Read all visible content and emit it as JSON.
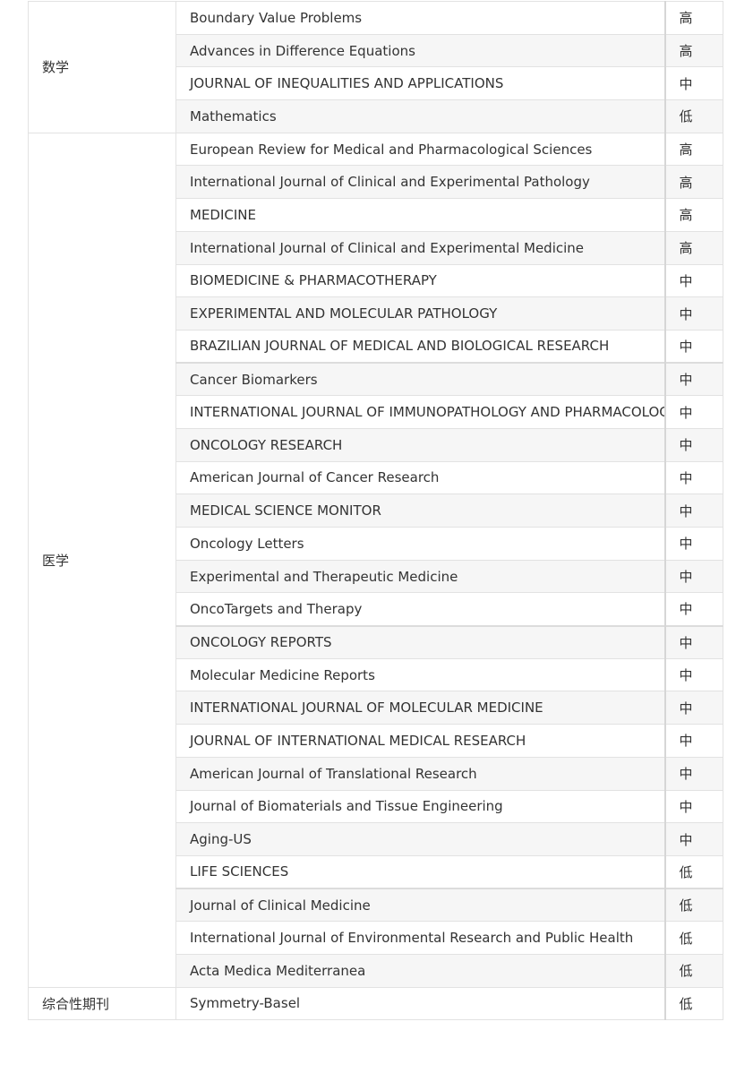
{
  "groups": [
    {
      "subject": "数学",
      "rows": [
        {
          "journal": "Boundary Value Problems",
          "level": "高"
        },
        {
          "journal": "Advances in Difference Equations",
          "level": "高"
        },
        {
          "journal": "JOURNAL OF INEQUALITIES AND APPLICATIONS",
          "level": "中"
        },
        {
          "journal": "Mathematics",
          "level": "低"
        }
      ]
    },
    {
      "subject": "医学",
      "rows": [
        {
          "journal": "European Review for Medical and Pharmacological Sciences",
          "level": "高"
        },
        {
          "journal": "International Journal of Clinical and Experimental Pathology",
          "level": "高"
        },
        {
          "journal": "MEDICINE",
          "level": "高"
        },
        {
          "journal": "International Journal of Clinical and Experimental Medicine",
          "level": "高"
        },
        {
          "journal": "BIOMEDICINE & PHARMACOTHERAPY",
          "level": "中"
        },
        {
          "journal": "EXPERIMENTAL AND MOLECULAR PATHOLOGY",
          "level": "中"
        },
        {
          "journal": "BRAZILIAN JOURNAL OF MEDICAL AND BIOLOGICAL RESEARCH",
          "level": "中"
        },
        {
          "journal": "Cancer Biomarkers",
          "level": "中"
        },
        {
          "journal": "INTERNATIONAL JOURNAL OF IMMUNOPATHOLOGY AND PHARMACOLOGY",
          "level": "中"
        },
        {
          "journal": "ONCOLOGY RESEARCH",
          "level": "中"
        },
        {
          "journal": "American Journal of Cancer Research",
          "level": "中"
        },
        {
          "journal": "MEDICAL SCIENCE MONITOR",
          "level": "中"
        },
        {
          "journal": "Oncology Letters",
          "level": "中"
        },
        {
          "journal": "Experimental and Therapeutic Medicine",
          "level": "中"
        },
        {
          "journal": "OncoTargets and Therapy",
          "level": "中"
        },
        {
          "journal": "ONCOLOGY REPORTS",
          "level": "中"
        },
        {
          "journal": "Molecular Medicine Reports",
          "level": "中"
        },
        {
          "journal": "INTERNATIONAL JOURNAL OF MOLECULAR MEDICINE",
          "level": "中"
        },
        {
          "journal": "JOURNAL OF INTERNATIONAL MEDICAL RESEARCH",
          "level": "中"
        },
        {
          "journal": "American Journal of Translational Research",
          "level": "中"
        },
        {
          "journal": "Journal of Biomaterials and Tissue Engineering",
          "level": "中"
        },
        {
          "journal": "Aging-US",
          "level": "中"
        },
        {
          "journal": "LIFE SCIENCES",
          "level": "低"
        },
        {
          "journal": "Journal of Clinical Medicine",
          "level": "低"
        },
        {
          "journal": "International Journal of Environmental Research and Public Health",
          "level": "低"
        },
        {
          "journal": "Acta Medica Mediterranea",
          "level": "低"
        }
      ]
    },
    {
      "subject": "综合性期刊",
      "rows": [
        {
          "journal": "Symmetry-Basel",
          "level": "低"
        }
      ]
    }
  ]
}
